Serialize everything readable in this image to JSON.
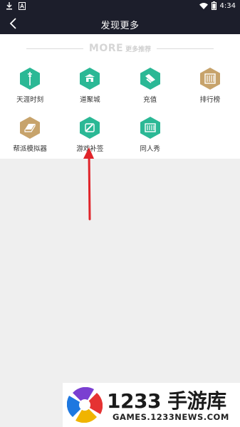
{
  "status_bar": {
    "time": "4:34",
    "icons": [
      "download-icon",
      "a-icon",
      "wifi-icon",
      "battery-icon"
    ]
  },
  "app_bar": {
    "title": "发现更多",
    "back_icon": "chevron-left-icon"
  },
  "more_header": {
    "title": "MORE",
    "subtitle": "更多推荐"
  },
  "items": [
    {
      "label": "天涯时刻",
      "icon": "pen-nib-icon",
      "color": "#2bb895"
    },
    {
      "label": "道聚城",
      "icon": "city-icon",
      "color": "#2bb895"
    },
    {
      "label": "充值",
      "icon": "card-icon",
      "color": "#2bb895"
    },
    {
      "label": "排行榜",
      "icon": "ranking-bars-icon",
      "color": "#c7a36b"
    },
    {
      "label": "帮派模拟器",
      "icon": "book-icon",
      "color": "#c7a36b"
    },
    {
      "label": "游戏补签",
      "icon": "check-pen-icon",
      "color": "#2bb895"
    },
    {
      "label": "同人秀",
      "icon": "gallery-icon",
      "color": "#2bb895"
    }
  ],
  "watermark": {
    "name": "1233 手游库",
    "url": "GAMES.1233NEWS.COM"
  },
  "colors": {
    "header_bg": "#1c1e2b",
    "teal": "#2bb895",
    "gold": "#c7a36b",
    "arrow": "#e0242a"
  }
}
